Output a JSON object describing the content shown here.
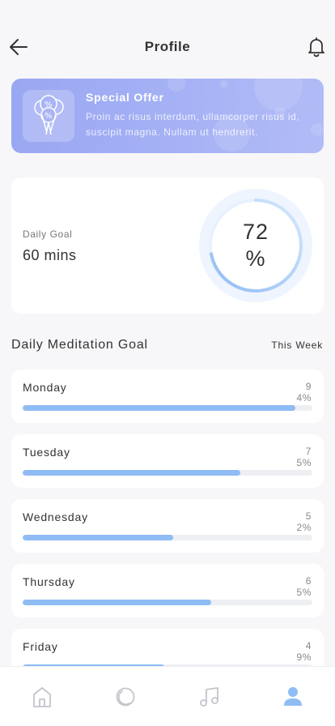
{
  "header": {
    "title": "Profile",
    "back_icon": "arrow-left-icon",
    "notification_icon": "bell-icon"
  },
  "offer": {
    "title": "Special Offer",
    "text": "Proin ac risus interdum, ullamcorper risus id, suscipit magna. Nullam ut hendrerit.",
    "icon": "balloons-percent-icon"
  },
  "daily_goal": {
    "label": "Daily Goal",
    "value": "60 mins",
    "progress_number": "72",
    "progress_unit": "%",
    "progress_fraction": 0.72
  },
  "section": {
    "title": "Daily Meditation Goal",
    "filter": "This Week"
  },
  "days": [
    {
      "name": "Monday",
      "value": "94",
      "unit": "%",
      "fraction": 0.94
    },
    {
      "name": "Tuesday",
      "value": "75",
      "unit": "%",
      "fraction": 0.75
    },
    {
      "name": "Wednesday",
      "value": "52",
      "unit": "%",
      "fraction": 0.52
    },
    {
      "name": "Thursday",
      "value": "65",
      "unit": "%",
      "fraction": 0.65
    },
    {
      "name": "Friday",
      "value": "49",
      "unit": "%",
      "fraction": 0.49
    }
  ],
  "tabbar": {
    "tabs": [
      "home-icon",
      "meditation-icon",
      "music-icon",
      "profile-icon"
    ],
    "active": "profile-icon"
  },
  "colors": {
    "accent": "#8fbcf4",
    "offer_bg": "#9aa7f2",
    "inactive_icon": "#c4c4cc",
    "track": "#eeeff2"
  }
}
